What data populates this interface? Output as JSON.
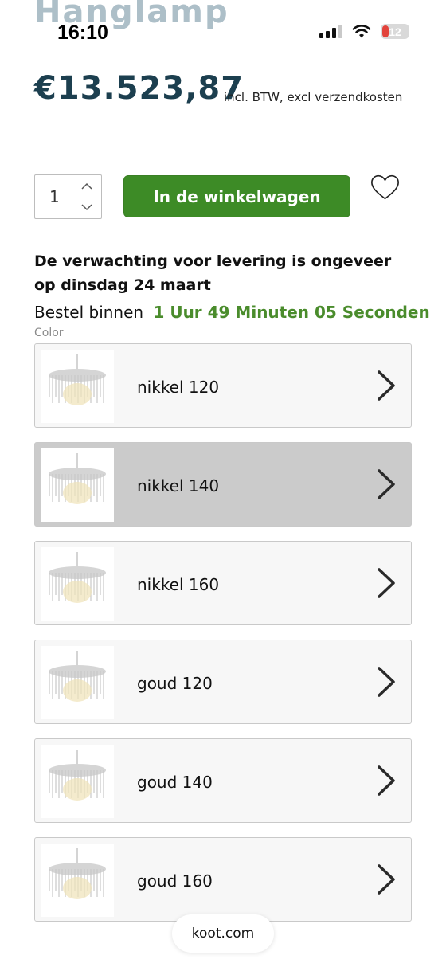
{
  "page": {
    "title_peek": "Hanglamp",
    "price": "€13.523,87",
    "price_note": "incl. BTW, excl verzendkosten"
  },
  "status_bar": {
    "time": "16:10",
    "battery": "12",
    "battery_color": "#e2433b"
  },
  "purchase": {
    "quantity": "1",
    "add_to_cart_label": "In de winkelwagen",
    "add_to_cart_color": "#3d8b26",
    "favorite_icon": "heart-icon"
  },
  "delivery": {
    "expectation": "De verwachting voor levering is ongeveer op dinsdag 24 maart",
    "order_within_label": "Bestel binnen",
    "countdown": "1 Uur 49 Minuten 05 Seconden",
    "countdown_color": "#4a8c2c"
  },
  "color_options": {
    "label": "Color",
    "selected_index": 1,
    "items": [
      {
        "label": "nikkel 120"
      },
      {
        "label": "nikkel 140"
      },
      {
        "label": "nikkel 160"
      },
      {
        "label": "goud 120"
      },
      {
        "label": "goud 140"
      },
      {
        "label": "goud 160"
      }
    ]
  },
  "browser": {
    "domain": "koot.com"
  }
}
